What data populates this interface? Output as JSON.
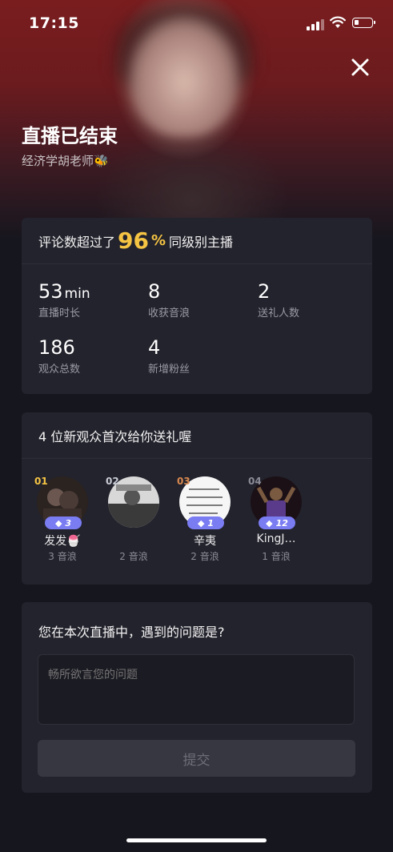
{
  "status_bar": {
    "time": "17:15",
    "battery_level": 0.25
  },
  "header": {
    "title": "直播已结束",
    "subtitle": "经济学胡老师🐝"
  },
  "stats_card": {
    "prefix": "评论数超过了",
    "percent_value": "96",
    "percent_sign": "%",
    "suffix": "同级别主播",
    "stats": [
      {
        "value": "53",
        "unit": "min",
        "label": "直播时长"
      },
      {
        "value": "8",
        "unit": "",
        "label": "收获音浪"
      },
      {
        "value": "2",
        "unit": "",
        "label": "送礼人数"
      },
      {
        "value": "186",
        "unit": "",
        "label": "观众总数"
      },
      {
        "value": "4",
        "unit": "",
        "label": "新增粉丝"
      }
    ]
  },
  "gifts_card": {
    "title": "4 位新观众首次给你送礼喔",
    "givers": [
      {
        "rank": "01",
        "rank_color": "#f5c443",
        "badge": "3",
        "name": "发发🍧",
        "sub": "3 音浪"
      },
      {
        "rank": "02",
        "rank_color": "#c9ccd6",
        "badge": "",
        "name": "",
        "sub": "2 音浪"
      },
      {
        "rank": "03",
        "rank_color": "#d9894f",
        "badge": "1",
        "name": "辛夷",
        "sub": "2 音浪"
      },
      {
        "rank": "04",
        "rank_color": "#8c8c98",
        "badge": "12",
        "name": "KingJ…",
        "sub": "1 音浪"
      }
    ]
  },
  "feedback_card": {
    "question": "您在本次直播中，遇到的问题是?",
    "placeholder": "畅所欲言您的问题",
    "submit_label": "提交"
  },
  "icons": {
    "close": "close-icon",
    "signal": "signal-icon",
    "wifi": "wifi-icon",
    "battery": "battery-icon",
    "diamond": "diamond-icon"
  }
}
